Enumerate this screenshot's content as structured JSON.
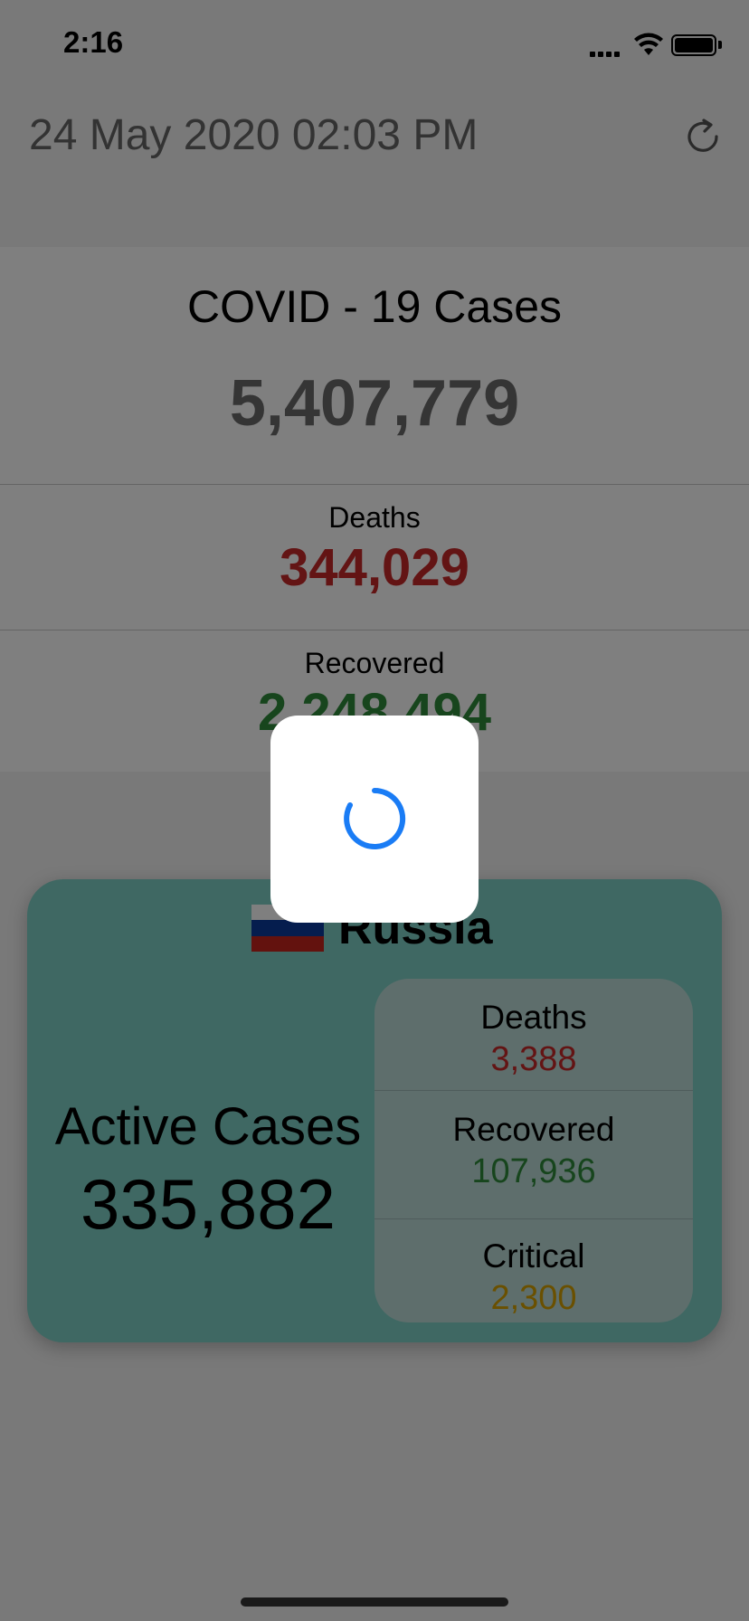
{
  "status_bar": {
    "time": "2:16"
  },
  "header": {
    "date": "24 May 2020 02:03 PM",
    "refresh_icon": "refresh-icon"
  },
  "global": {
    "title": "COVID - 19 Cases",
    "total": "5,407,779",
    "deaths_label": "Deaths",
    "deaths_value": "344,029",
    "recovered_label": "Recovered",
    "recovered_value": "2,248,494"
  },
  "country": {
    "flag_icon": "russia-flag-icon",
    "name": "Russia",
    "active_label": "Active Cases",
    "active_value": "335,882",
    "stats": [
      {
        "label": "Deaths",
        "value": "3,388"
      },
      {
        "label": "Recovered",
        "value": "107,936"
      },
      {
        "label": "Critical",
        "value": "2,300"
      }
    ]
  },
  "colors": {
    "deaths": "#c62828",
    "recovered": "#2e8b3a",
    "critical": "#d4a100",
    "spinner": "#1a7cf5",
    "card": "#7fd1c6"
  },
  "loading": {
    "visible": true
  }
}
